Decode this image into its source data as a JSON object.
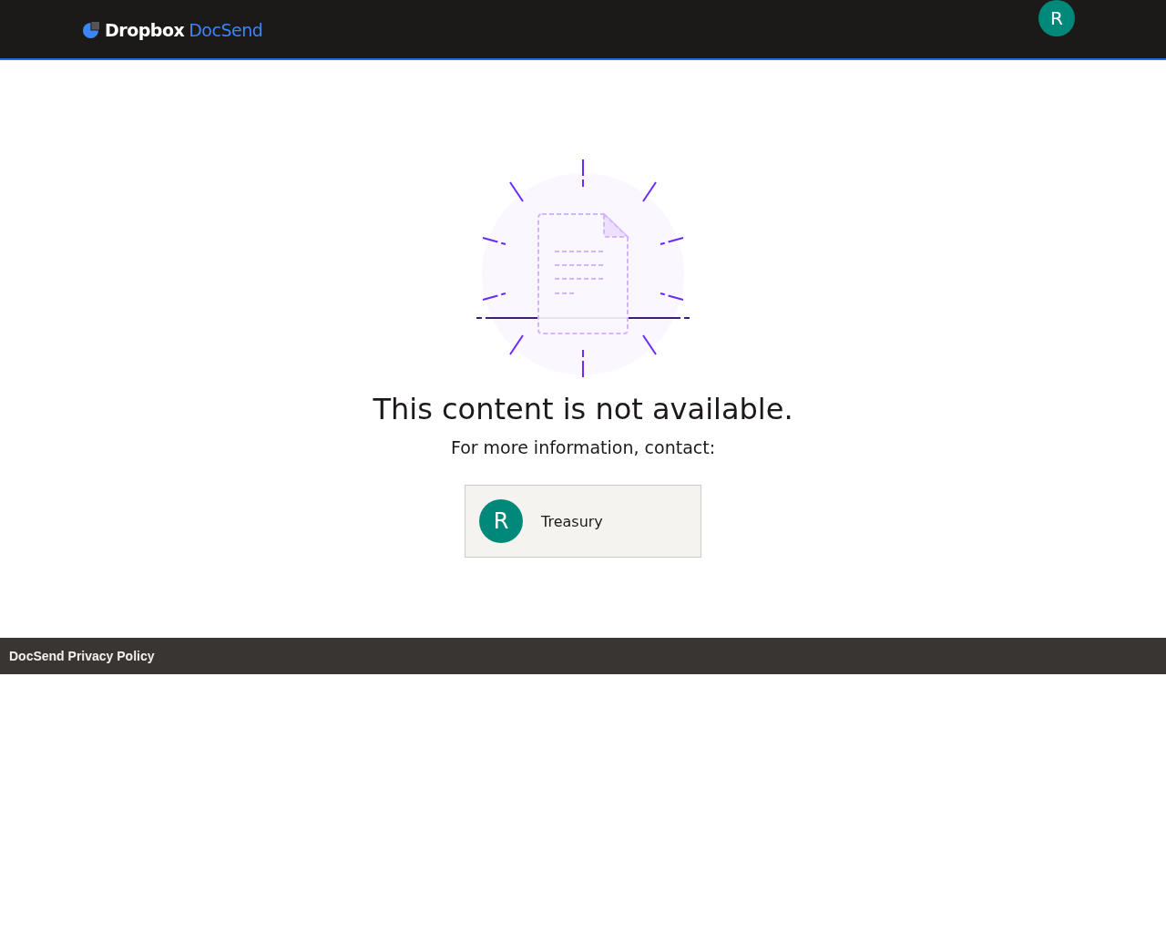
{
  "header": {
    "logo": {
      "brand": "Dropbox",
      "product": "DocSend"
    },
    "avatar_initial": "R"
  },
  "message": {
    "title": "This content is not available.",
    "subtitle": "For more information, contact:"
  },
  "contact": {
    "initial": "R",
    "name": "Treasury"
  },
  "footer": {
    "link": "DocSend Privacy Policy"
  }
}
